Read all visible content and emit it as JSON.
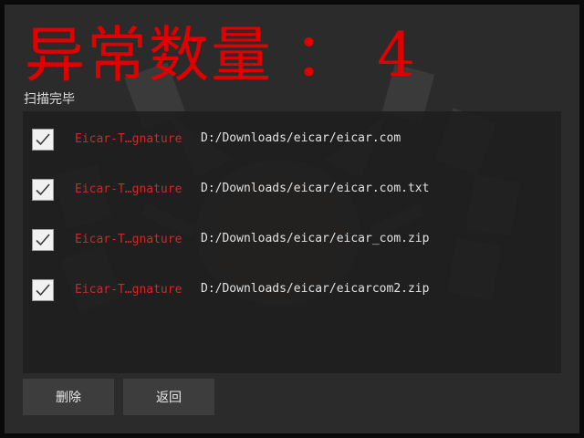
{
  "header": {
    "anomaly_label": "异常数量",
    "separator": "：",
    "anomaly_count": "4",
    "status": "扫描完毕"
  },
  "results": [
    {
      "threat": "Eicar-T…gnature",
      "path": "D:/Downloads/eicar/eicar.com",
      "checked": true
    },
    {
      "threat": "Eicar-T…gnature",
      "path": "D:/Downloads/eicar/eicar.com.txt",
      "checked": true
    },
    {
      "threat": "Eicar-T…gnature",
      "path": "D:/Downloads/eicar/eicar_com.zip",
      "checked": true
    },
    {
      "threat": "Eicar-T…gnature",
      "path": "D:/Downloads/eicar/eicarcom2.zip",
      "checked": true
    }
  ],
  "buttons": {
    "delete_label": "删除",
    "back_label": "返回"
  },
  "colors": {
    "headline": "#e00000",
    "threat_text": "#d02828",
    "background": "#2b2b2b"
  }
}
